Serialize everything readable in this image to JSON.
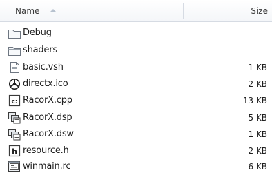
{
  "header": {
    "name_label": "Name",
    "size_label": "Size"
  },
  "files": [
    {
      "name": "Debug",
      "size": "",
      "icon": "folder-icon"
    },
    {
      "name": "shaders",
      "size": "",
      "icon": "folder-icon"
    },
    {
      "name": "basic.vsh",
      "size": "1 KB",
      "icon": "text-file-icon"
    },
    {
      "name": "directx.ico",
      "size": "2 KB",
      "icon": "directx-icon"
    },
    {
      "name": "RacorX.cpp",
      "size": "13 KB",
      "icon": "cpp-file-icon"
    },
    {
      "name": "RacorX.dsp",
      "size": "5 KB",
      "icon": "project-file-icon"
    },
    {
      "name": "RacorX.dsw",
      "size": "1 KB",
      "icon": "workspace-file-icon"
    },
    {
      "name": "resource.h",
      "size": "2 KB",
      "icon": "header-file-icon"
    },
    {
      "name": "winmain.rc",
      "size": "6 KB",
      "icon": "resource-file-icon"
    }
  ]
}
